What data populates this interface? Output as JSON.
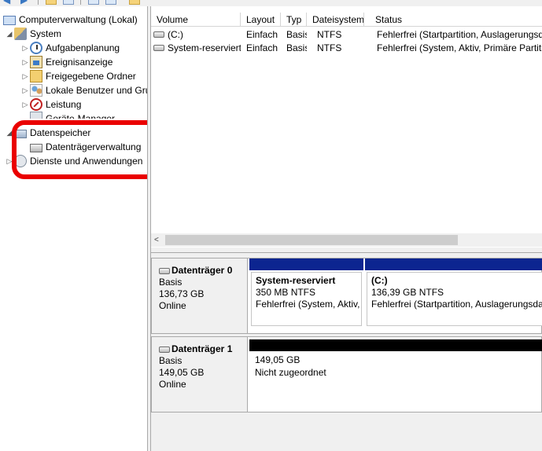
{
  "toolbar": {
    "icons": [
      "back-arrow-icon",
      "forward-arrow-icon",
      "folder-up-icon",
      "show-hide-tree-icon",
      "properties-icon",
      "help-icon",
      "export-icon"
    ]
  },
  "tree": {
    "items": [
      {
        "label": "Computerverwaltung (Lokal)",
        "icon": "computer-management-icon"
      },
      {
        "label": "System",
        "icon": "system-tools-icon"
      },
      {
        "label": "Aufgabenplanung",
        "icon": "clock-icon"
      },
      {
        "label": "Ereignisanzeige",
        "icon": "event-viewer-icon"
      },
      {
        "label": "Freigegebene Ordner",
        "icon": "shared-folder-icon"
      },
      {
        "label": "Lokale Benutzer und Gru",
        "icon": "users-icon"
      },
      {
        "label": "Leistung",
        "icon": "performance-icon"
      },
      {
        "label": "Geräte-Manager",
        "icon": "device-manager-icon"
      },
      {
        "label": "Datenspeicher",
        "icon": "storage-icon"
      },
      {
        "label": "Datenträgerverwaltung",
        "icon": "disk-icon"
      },
      {
        "label": "Dienste und Anwendungen",
        "icon": "services-icon"
      }
    ]
  },
  "volumes": {
    "columns": [
      "Volume",
      "Layout",
      "Typ",
      "Dateisystem",
      "Status"
    ],
    "rows": [
      {
        "volume": "(C:)",
        "layout": "Einfach",
        "type": "Basis",
        "fs": "NTFS",
        "status": "Fehlerfrei (Startpartition, Auslagerungsdatei"
      },
      {
        "volume": "System-reserviert",
        "layout": "Einfach",
        "type": "Basis",
        "fs": "NTFS",
        "status": "Fehlerfrei (System, Aktiv, Primäre Partition"
      }
    ]
  },
  "disks": [
    {
      "name": "Datenträger 0",
      "type": "Basis",
      "size": "136,73 GB",
      "state": "Online",
      "partitions": [
        {
          "name": "System-reserviert",
          "size": "350 MB NTFS",
          "status": "Fehlerfrei (System, Aktiv,"
        },
        {
          "name": "(C:)",
          "size": "136,39 GB NTFS",
          "status": "Fehlerfrei (Startpartition, Auslagerungsdatei"
        }
      ]
    },
    {
      "name": "Datenträger 1",
      "type": "Basis",
      "size": "149,05 GB",
      "state": "Online",
      "unallocated": {
        "size": "149,05 GB",
        "status": "Nicht zugeordnet"
      }
    }
  ],
  "colors": {
    "highlight": "#ea0000",
    "primary_partition_bar": "#0c2590",
    "unallocated_bar": "#000000"
  }
}
